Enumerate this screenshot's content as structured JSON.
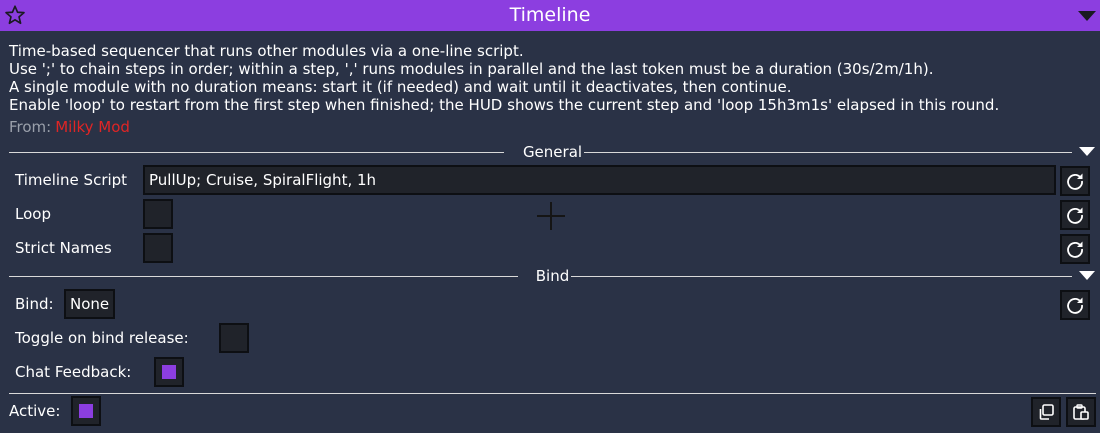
{
  "window": {
    "title": "Timeline"
  },
  "description": {
    "lines": [
      "Time-based sequencer that runs other modules via a one-line script.",
      "Use ';' to chain steps in order; within a step, ',' runs modules in parallel and the last token must be a duration (30s/2m/1h).",
      "A single module with no duration means: start it (if needed) and wait until it deactivates, then continue.",
      "Enable 'loop' to restart from the first step when finished; the HUD shows the current step and 'loop 15h3m1s' elapsed in this round."
    ],
    "from_label": "From:",
    "from_value": "Milky Mod"
  },
  "general": {
    "header": "General",
    "timeline_script": {
      "label": "Timeline Script",
      "value": "PullUp; Cruise, SpiralFlight, 1h"
    },
    "loop": {
      "label": "Loop",
      "checked": false
    },
    "strict_names": {
      "label": "Strict Names",
      "checked": false
    }
  },
  "bind": {
    "header": "Bind",
    "bind_setting": {
      "label": "Bind:",
      "value": "None"
    },
    "toggle_on_release": {
      "label": "Toggle on bind release:",
      "checked": false
    },
    "chat_feedback": {
      "label": "Chat Feedback:",
      "checked": true
    }
  },
  "footer": {
    "active_label": "Active:",
    "active_checked": true
  },
  "icons": {
    "title_left": "star-icon",
    "title_right": "chevron-down-icon",
    "reset": "reset-icon",
    "copy": "copy-icon",
    "paste": "paste-icon"
  },
  "colors": {
    "accent": "#8c3ee0",
    "background": "#2a3246",
    "control": "#20232a",
    "source": "#e02525"
  }
}
